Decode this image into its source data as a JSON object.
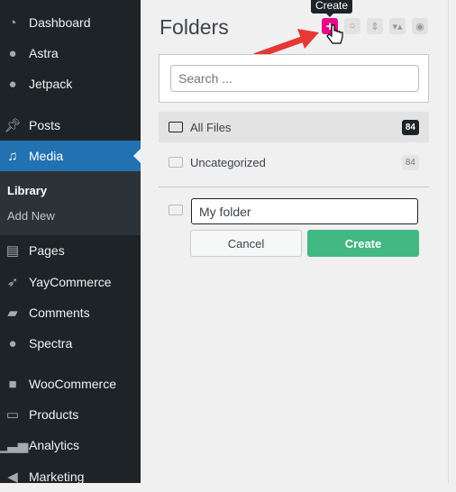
{
  "sidebar": {
    "items": [
      {
        "label": "Dashboard",
        "icon": "dashboard-icon"
      },
      {
        "label": "Astra",
        "icon": "astra-icon"
      },
      {
        "label": "Jetpack",
        "icon": "jetpack-icon"
      },
      {
        "label": "Posts",
        "icon": "pin-icon"
      },
      {
        "label": "Media",
        "icon": "media-icon",
        "active": true
      },
      {
        "label": "Pages",
        "icon": "pages-icon"
      },
      {
        "label": "YayCommerce",
        "icon": "yaycommerce-icon"
      },
      {
        "label": "Comments",
        "icon": "comment-icon"
      },
      {
        "label": "Spectra",
        "icon": "spectra-icon"
      },
      {
        "label": "WooCommerce",
        "icon": "woo-icon"
      },
      {
        "label": "Products",
        "icon": "archive-icon"
      },
      {
        "label": "Analytics",
        "icon": "bar-chart-icon"
      },
      {
        "label": "Marketing",
        "icon": "megaphone-icon"
      }
    ],
    "submenu": [
      {
        "label": "Library",
        "current": true
      },
      {
        "label": "Add New"
      }
    ]
  },
  "folders": {
    "title": "Folders",
    "tooltip": "Create",
    "search_placeholder": "Search ...",
    "items": [
      {
        "label": "All Files",
        "count": "84"
      },
      {
        "label": "Uncategorized",
        "count": "84"
      }
    ],
    "new_folder_value": "My folder",
    "cancel_label": "Cancel",
    "create_label": "Create"
  },
  "colors": {
    "accent": "#2271b1",
    "create_button": "#e8088b",
    "create_confirm": "#42b883"
  }
}
